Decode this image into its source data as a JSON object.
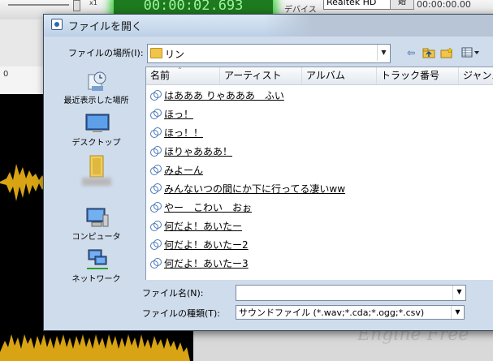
{
  "background_app": {
    "zoom_label": "x1",
    "timer": "00:00:02.693",
    "device_label": "デバイス",
    "device_value": "Realtek HD",
    "mini_button": "始",
    "time_readout": "00:00:00.00",
    "ruler_start": "0",
    "brand_watermark": "Engine Free",
    "colors": {
      "waveform": "#d9a414",
      "timer_glow": "#46d046"
    }
  },
  "dialog": {
    "title": "ファイルを開く",
    "location_label": "ファイルの場所(I):",
    "location_value": "リン",
    "toolbar": {
      "back_icon": "back-arrow-icon",
      "up_icon": "folder-up-icon",
      "new_folder_icon": "new-folder-icon",
      "views_icon": "views-menu-icon"
    },
    "places": [
      {
        "label": "最近表示した場所",
        "icon": "recent-places-icon"
      },
      {
        "label": "デスクトップ",
        "icon": "desktop-icon"
      },
      {
        "label": "",
        "icon": "user-folder-icon"
      },
      {
        "label": "コンピュータ",
        "icon": "computer-icon"
      },
      {
        "label": "ネットワーク",
        "icon": "network-icon"
      }
    ],
    "columns": [
      "名前",
      "アーティスト",
      "アルバム",
      "トラック番号",
      "ジャンル"
    ],
    "files": [
      "はあああ りゃあああ　ふい",
      "ほっ！",
      "ほっ！！",
      "ほりゃあああ！",
      "みよーん",
      "みんないつの間にか下に行ってる凄いww",
      "やー　こわい　おぉ",
      "何だよ！あいたー",
      "何だよ！あいたー2",
      "何だよ！あいたー3"
    ],
    "filename_label": "ファイル名(N):",
    "filename_value": "",
    "filetype_label": "ファイルの種類(T):",
    "filetype_value": "サウンドファイル (*.wav;*.cda;*.ogg;*.csv)"
  }
}
